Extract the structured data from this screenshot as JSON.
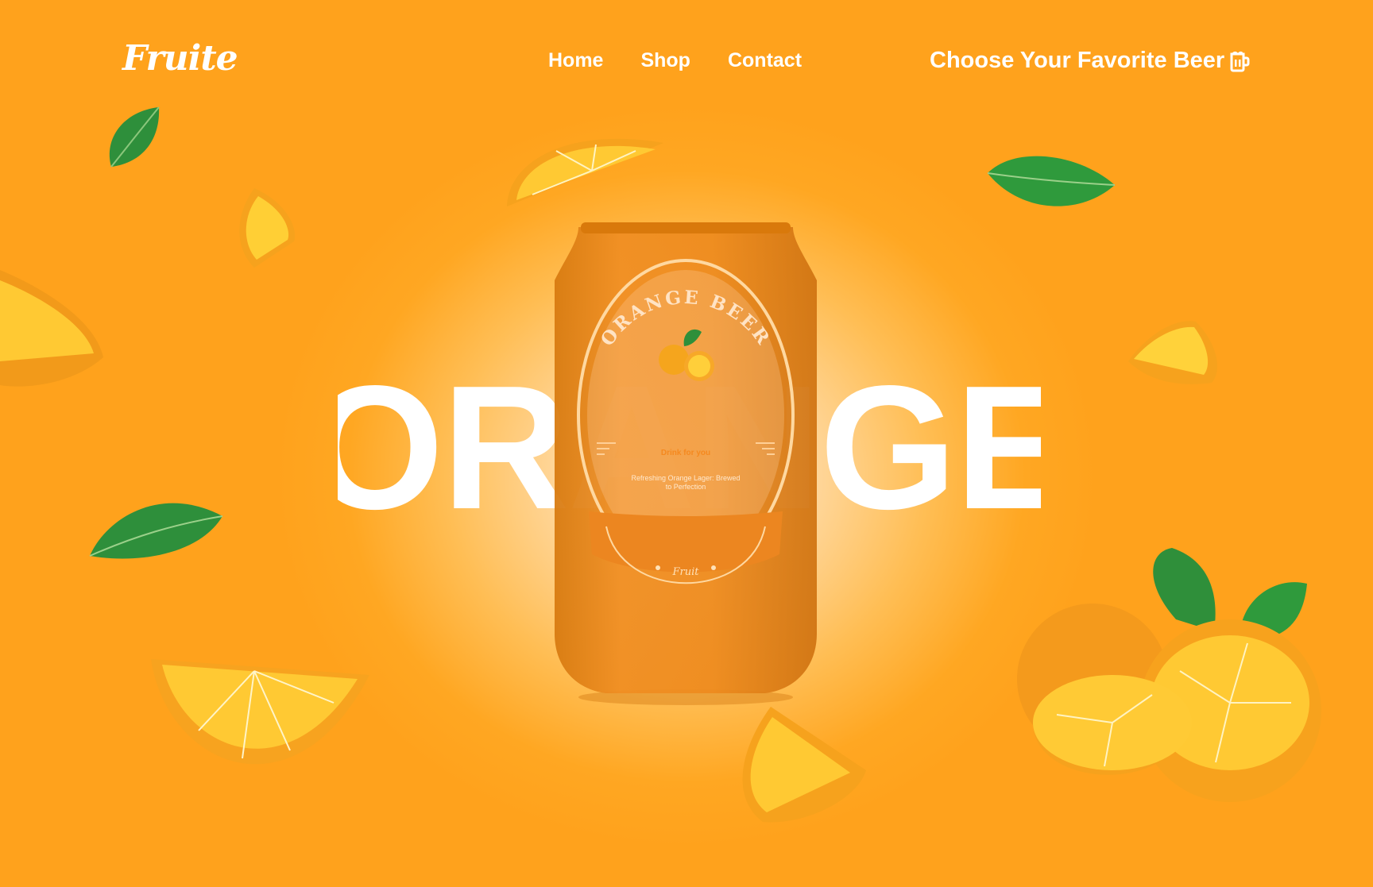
{
  "brand": {
    "logo": "Fruite"
  },
  "nav": {
    "items": [
      "Home",
      "Shop",
      "Contact"
    ]
  },
  "header": {
    "tagline": "Choose Your Favorite Beer",
    "cart_icon": "beer-mug-icon"
  },
  "hero": {
    "big_word": "ORANGE",
    "can": {
      "label_arc_title": "ORANGE BEER",
      "subtitle": "Drink for you",
      "description_line1": "Refreshing Orange Lager: Brewed",
      "description_line2": "to Perfection",
      "brand_mark": "Fruit"
    }
  },
  "colors": {
    "accent": "#ffa21c",
    "can_body": "#ee8a1e",
    "leaf": "#2e8f3b",
    "orange_peel": "#f6a21d",
    "orange_flesh": "#ffc933"
  }
}
